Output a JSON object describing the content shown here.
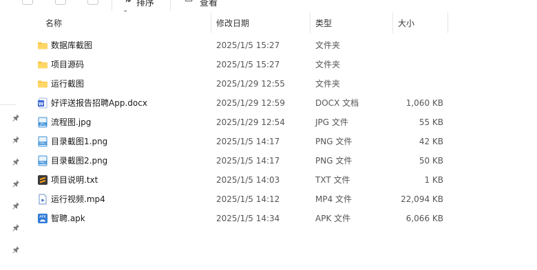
{
  "toolbar": {
    "sort_label": "排序",
    "view_label": "查看"
  },
  "columns": {
    "name": "名称",
    "date": "修改日期",
    "type": "类型",
    "size": "大小"
  },
  "files": [
    {
      "name": "数据库截图",
      "date": "2025/1/5 15:27",
      "type": "文件夹",
      "size": "",
      "icon": "folder-icon"
    },
    {
      "name": "项目源码",
      "date": "2025/1/5 15:27",
      "type": "文件夹",
      "size": "",
      "icon": "folder-icon"
    },
    {
      "name": "运行截图",
      "date": "2025/1/29 12:55",
      "type": "文件夹",
      "size": "",
      "icon": "folder-icon"
    },
    {
      "name": "好评送报告招聘App.docx",
      "date": "2025/1/29 12:59",
      "type": "DOCX 文档",
      "size": "1,060 KB",
      "icon": "word-doc-icon"
    },
    {
      "name": "流程图.jpg",
      "date": "2025/1/29 12:54",
      "type": "JPG 文件",
      "size": "55 KB",
      "icon": "jpg-image-icon"
    },
    {
      "name": "目录截图1.png",
      "date": "2025/1/5 14:17",
      "type": "PNG 文件",
      "size": "42 KB",
      "icon": "png-image-icon"
    },
    {
      "name": "目录截图2.png",
      "date": "2025/1/5 14:17",
      "type": "PNG 文件",
      "size": "50 KB",
      "icon": "png-image-icon"
    },
    {
      "name": "项目说明.txt",
      "date": "2025/1/5 14:03",
      "type": "TXT 文件",
      "size": "1 KB",
      "icon": "sublime-text-icon"
    },
    {
      "name": "运行视频.mp4",
      "date": "2025/1/5 14:12",
      "type": "MP4 文件",
      "size": "22,094 KB",
      "icon": "video-file-icon"
    },
    {
      "name": "智聘.apk",
      "date": "2025/1/5 14:34",
      "type": "APK 文件",
      "size": "6,066 KB",
      "icon": "apk-file-icon"
    }
  ],
  "colors": {
    "folder": "#F8C646",
    "word": "#2B5CD6",
    "image": "#3A8FD9",
    "sublime": "#3A3A3A"
  }
}
